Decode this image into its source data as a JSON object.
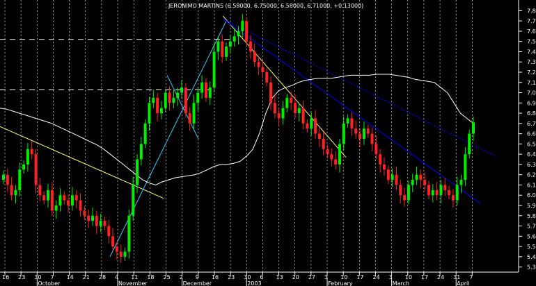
{
  "chart_data": {
    "type": "candlestick",
    "title": "JERONIMO MARTINS (6.58000, 6.75000, 6.58000, 6.71000, +0.13000)",
    "ylim": [
      5.25,
      7.85
    ],
    "y_ticks": [
      "5.3",
      "5.4",
      "5.5",
      "5.6",
      "5.7",
      "5.8",
      "5.9",
      "6.0",
      "6.1",
      "6.2",
      "6.3",
      "6.4",
      "6.5",
      "6.6",
      "6.7",
      "6.8",
      "6.9",
      "7.0",
      "7.1",
      "7.2",
      "7.3",
      "7.4",
      "7.5",
      "7.6",
      "7.7",
      "7.8"
    ],
    "x_day_ticks": [
      "16",
      "23",
      "30",
      "7",
      "14",
      "21",
      "28",
      "4",
      "11",
      "18",
      "25",
      "2",
      "9",
      "16",
      "23",
      "30",
      "6",
      "13",
      "20",
      "27",
      "3",
      "10",
      "17",
      "24",
      "3",
      "10",
      "17",
      "24",
      "31",
      "7"
    ],
    "x_month_labels": [
      "October",
      "November",
      "December",
      "2003",
      "February",
      "March",
      "April"
    ],
    "grid": true,
    "colors": {
      "up": "#00ee00",
      "down": "#ff2222",
      "envelope": "#ffffff",
      "trend_yellow": "#ffff66",
      "trend_cyan": "#33ccff",
      "trend_blue": "#0000ff",
      "support_dash": "#ffffff"
    },
    "closes": [
      6.2,
      6.1,
      6.0,
      6.05,
      6.25,
      6.3,
      6.45,
      6.4,
      6.1,
      6.0,
      5.95,
      6.05,
      5.85,
      5.9,
      6.0,
      5.95,
      5.9,
      6.0,
      5.95,
      5.85,
      5.8,
      5.75,
      5.8,
      5.7,
      5.75,
      5.7,
      5.6,
      5.5,
      5.45,
      5.4,
      5.45,
      5.8,
      6.1,
      6.35,
      6.5,
      6.7,
      6.9,
      6.95,
      6.8,
      6.85,
      7.0,
      6.9,
      6.95,
      7.0,
      7.05,
      6.8,
      6.7,
      6.9,
      7.0,
      7.1,
      6.95,
      7.05,
      7.4,
      7.5,
      7.35,
      7.45,
      7.5,
      7.55,
      7.6,
      7.7,
      7.5,
      7.4,
      7.3,
      7.25,
      7.2,
      7.1,
      6.9,
      6.8,
      6.75,
      6.85,
      6.95,
      6.9,
      6.8,
      6.85,
      6.7,
      6.65,
      6.75,
      6.6,
      6.55,
      6.45,
      6.4,
      6.35,
      6.3,
      6.5,
      6.7,
      6.75,
      6.65,
      6.6,
      6.55,
      6.65,
      6.6,
      6.5,
      6.4,
      6.3,
      6.25,
      6.15,
      6.2,
      6.1,
      6.0,
      5.95,
      6.1,
      6.15,
      6.2,
      6.15,
      6.1,
      6.0,
      6.05,
      6.0,
      6.1,
      6.05,
      6.0,
      5.95,
      6.1,
      6.15,
      6.4,
      6.6,
      6.71
    ],
    "envelope": [
      6.85,
      6.84,
      6.82,
      6.8,
      6.78,
      6.76,
      6.74,
      6.72,
      6.7,
      6.67,
      6.64,
      6.61,
      6.58,
      6.55,
      6.52,
      6.49,
      6.45,
      6.4,
      6.35,
      6.3,
      6.25,
      6.2,
      6.15,
      6.12,
      6.1,
      6.13,
      6.15,
      6.17,
      6.18,
      6.19,
      6.2,
      6.22,
      6.25,
      6.28,
      6.3,
      6.3,
      6.31,
      6.33,
      6.38,
      6.45,
      6.6,
      6.8,
      6.95,
      7.02,
      7.05,
      7.07,
      7.1,
      7.12,
      7.13,
      7.14,
      7.14,
      7.14,
      7.15,
      7.16,
      7.17,
      7.17,
      7.17,
      7.17,
      7.18,
      7.18,
      7.18,
      7.17,
      7.16,
      7.15,
      7.13,
      7.12,
      7.11,
      7.1,
      7.05,
      7.0,
      6.9,
      6.8,
      6.75,
      6.7
    ]
  }
}
